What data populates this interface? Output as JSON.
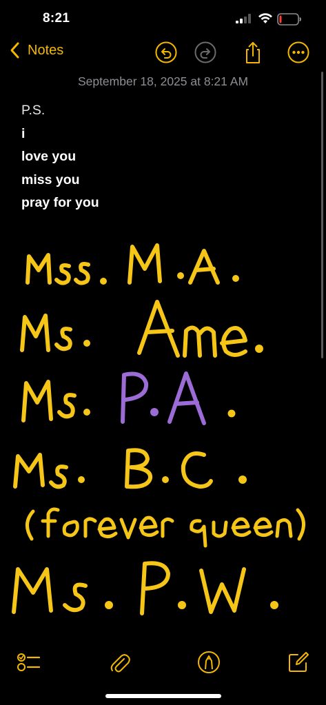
{
  "status_bar": {
    "time": "8:21",
    "battery_level": 0.12,
    "battery_color": "#ff3b30"
  },
  "nav": {
    "back_label": "Notes",
    "accent_color": "#f5b800",
    "icons": [
      "chevron-left-icon",
      "undo-icon",
      "redo-icon",
      "share-icon",
      "more-icon"
    ]
  },
  "note": {
    "date": "September 18, 2025 at 8:21 AM",
    "lines": [
      "P.S.",
      "i",
      "love you",
      "miss you",
      "pray for you"
    ]
  },
  "drawing": {
    "ink_colors": {
      "yellow": "#f5c518",
      "purple": "#9b6bd6"
    },
    "handwritten_lines": [
      "Ms. M.A.",
      "Ms. Ame.",
      "Ms. P.A.",
      "Ms. B.C.",
      "(forever queen)",
      "Ms. P.W."
    ]
  },
  "toolbar": {
    "icons": [
      "checklist-icon",
      "paperclip-icon",
      "markup-pen-icon",
      "compose-icon"
    ]
  }
}
